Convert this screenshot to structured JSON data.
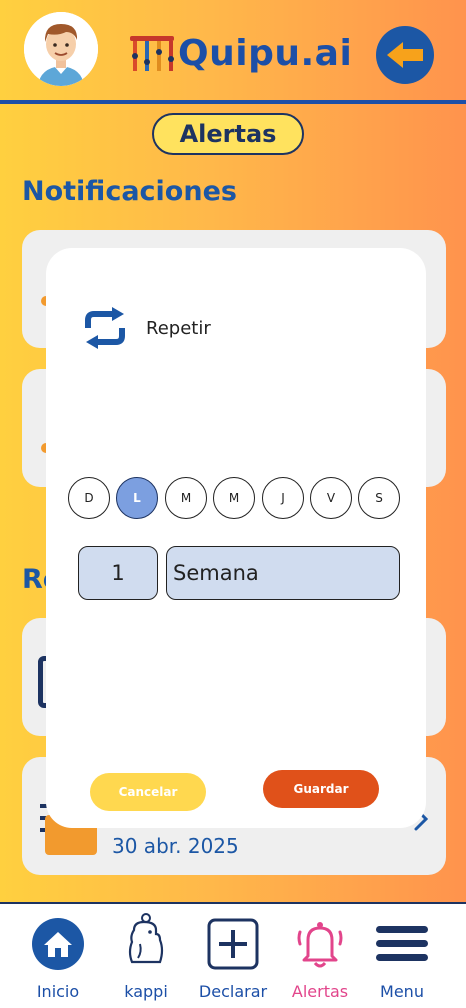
{
  "header": {
    "logo_text": "Quipu.ai"
  },
  "section_title": "Alertas",
  "notifications": {
    "title": "Notificaciones"
  },
  "reminders": {
    "title_fragment": "Re",
    "card_date": "30 abr. 2025"
  },
  "modal": {
    "repeat_label": "Repetir",
    "days": [
      {
        "label": "D",
        "selected": false
      },
      {
        "label": "L",
        "selected": true
      },
      {
        "label": "M",
        "selected": false
      },
      {
        "label": "M",
        "selected": false
      },
      {
        "label": "J",
        "selected": false
      },
      {
        "label": "V",
        "selected": false
      },
      {
        "label": "S",
        "selected": false
      }
    ],
    "interval_value": "1",
    "interval_unit": "Semana",
    "cancel_label": "Cancelar",
    "save_label": "Guardar"
  },
  "nav": {
    "items": [
      {
        "label": "Inicio",
        "icon": "home-icon",
        "active": false
      },
      {
        "label": "kappi",
        "icon": "capybara-icon",
        "active": false
      },
      {
        "label": "Declarar",
        "icon": "plus-square-icon",
        "active": false
      },
      {
        "label": "Alertas",
        "icon": "bell-icon",
        "active": true
      },
      {
        "label": "Menu",
        "icon": "hamburger-icon",
        "active": false
      }
    ]
  },
  "colors": {
    "brand_blue": "#1c57a5",
    "dark_navy": "#1d3361",
    "accent_pink": "#e2458b",
    "save_orange": "#e0511a",
    "cancel_yellow": "#ffd84f",
    "selected_day": "#7c9fe0"
  }
}
